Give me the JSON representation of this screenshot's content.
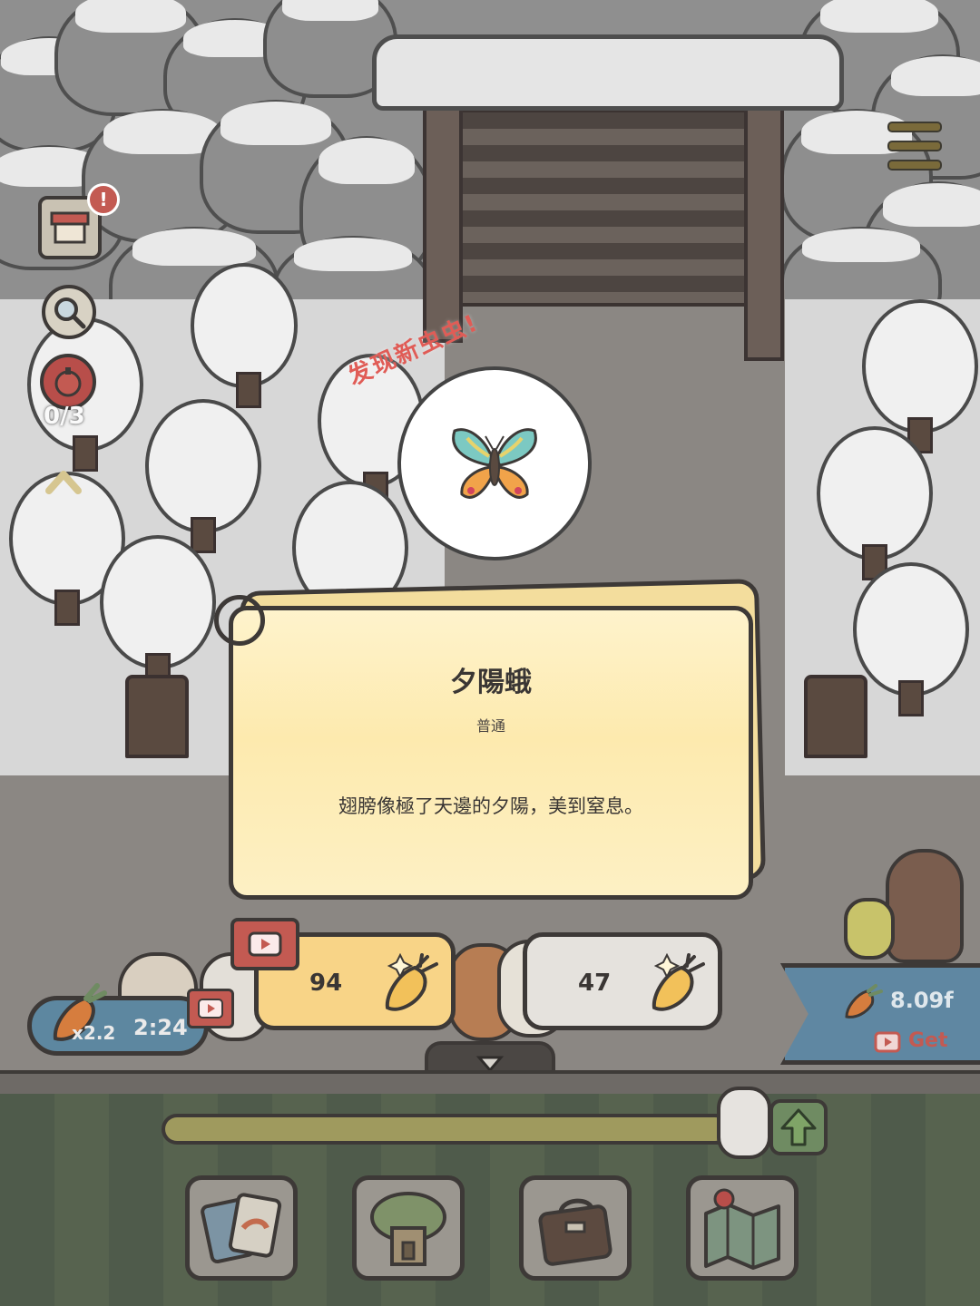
{
  "discovery": {
    "label": "发现新虫虫!",
    "bug_icon": "sunset-moth-icon"
  },
  "card": {
    "title": "夕陽蛾",
    "rarity": "普通",
    "description": "翅膀像極了天邊的夕陽，美到窒息。"
  },
  "rewards": {
    "video_option_value": "94",
    "free_option_value": "47"
  },
  "sidebar": {
    "alert_badge": "!",
    "bug_counter": "0/3",
    "expand_icon": "chevron-up-icon"
  },
  "boost": {
    "multiplier": "x2.2",
    "timer": "2:24"
  },
  "offer": {
    "value": "8.09f",
    "get_label": "Get"
  },
  "level_progress": 0.98,
  "nav": {
    "items": [
      "cards-icon",
      "tree-house-icon",
      "bag-icon",
      "map-icon"
    ]
  },
  "colors": {
    "accent_red": "#c35a52",
    "card_bg": "#fdeaae",
    "reward_gold": "#f8d487",
    "offer_blue": "#5f87a2"
  }
}
